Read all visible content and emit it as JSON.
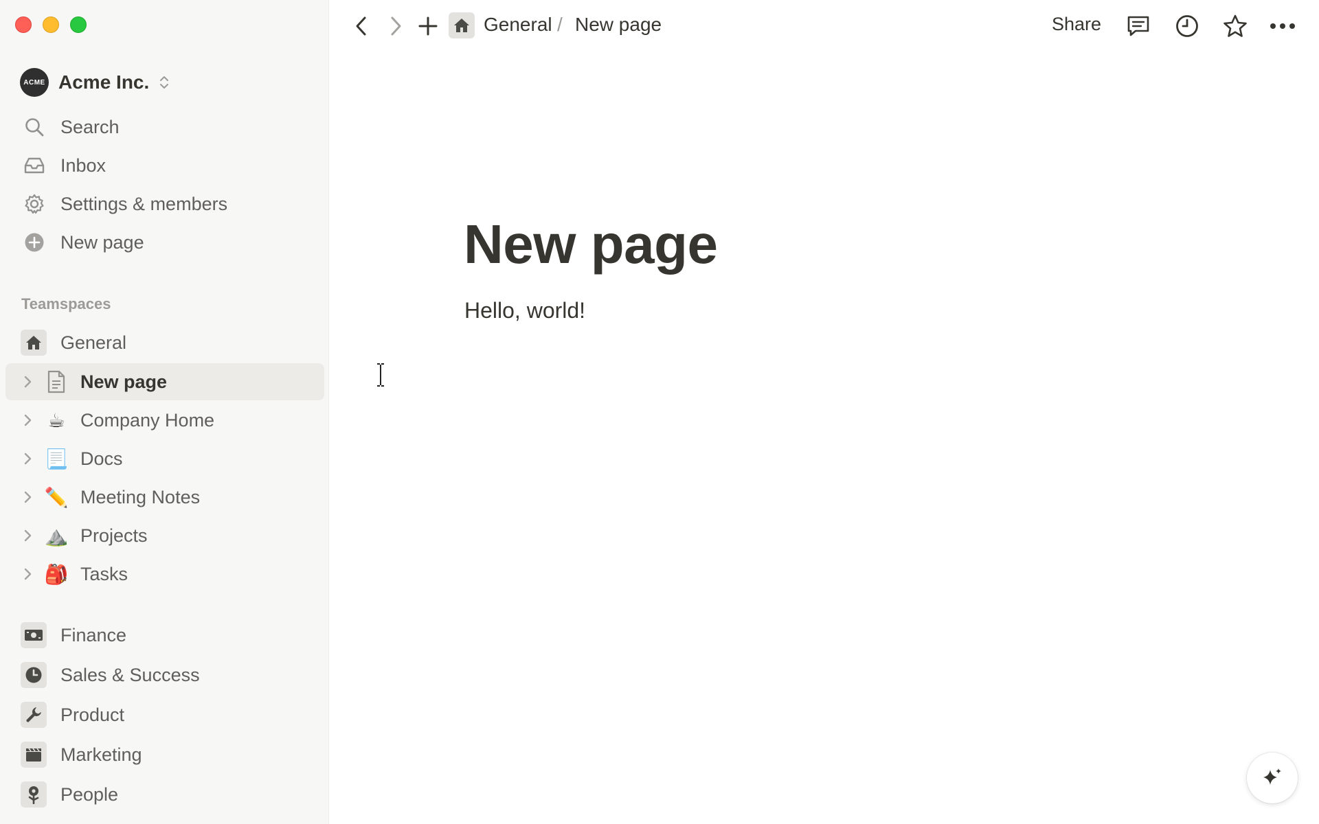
{
  "workspace": {
    "name": "Acme Inc.",
    "logo_text": "ACME"
  },
  "sidebar": {
    "nav": [
      {
        "label": "Search",
        "icon": "search-icon"
      },
      {
        "label": "Inbox",
        "icon": "inbox-icon"
      },
      {
        "label": "Settings & members",
        "icon": "gear-icon"
      },
      {
        "label": "New page",
        "icon": "plus-circle-icon"
      }
    ],
    "teamspaces_label": "Teamspaces",
    "general": {
      "label": "General",
      "icon": "home-icon"
    },
    "pages": [
      {
        "label": "New page",
        "icon": "document-icon",
        "active": true
      },
      {
        "label": "Company Home",
        "icon": "☕"
      },
      {
        "label": "Docs",
        "icon": "📃"
      },
      {
        "label": "Meeting Notes",
        "icon": "✏️"
      },
      {
        "label": "Projects",
        "icon": "⛰️"
      },
      {
        "label": "Tasks",
        "icon": "🎒"
      }
    ],
    "teams": [
      {
        "label": "Finance",
        "icon": "banknote-icon"
      },
      {
        "label": "Sales & Success",
        "icon": "clock-icon"
      },
      {
        "label": "Product",
        "icon": "wrench-icon"
      },
      {
        "label": "Marketing",
        "icon": "clapper-icon"
      },
      {
        "label": "People",
        "icon": "flower-icon"
      }
    ]
  },
  "topbar": {
    "breadcrumb": {
      "parent": "General",
      "separator": "/",
      "current": "New page"
    },
    "share_label": "Share"
  },
  "page": {
    "title": "New page",
    "body": "Hello, world!"
  },
  "colors": {
    "sidebar_bg": "#f7f7f5",
    "text": "#37352f",
    "muted": "#5f5e5b",
    "active_row": "#ecebe8"
  }
}
